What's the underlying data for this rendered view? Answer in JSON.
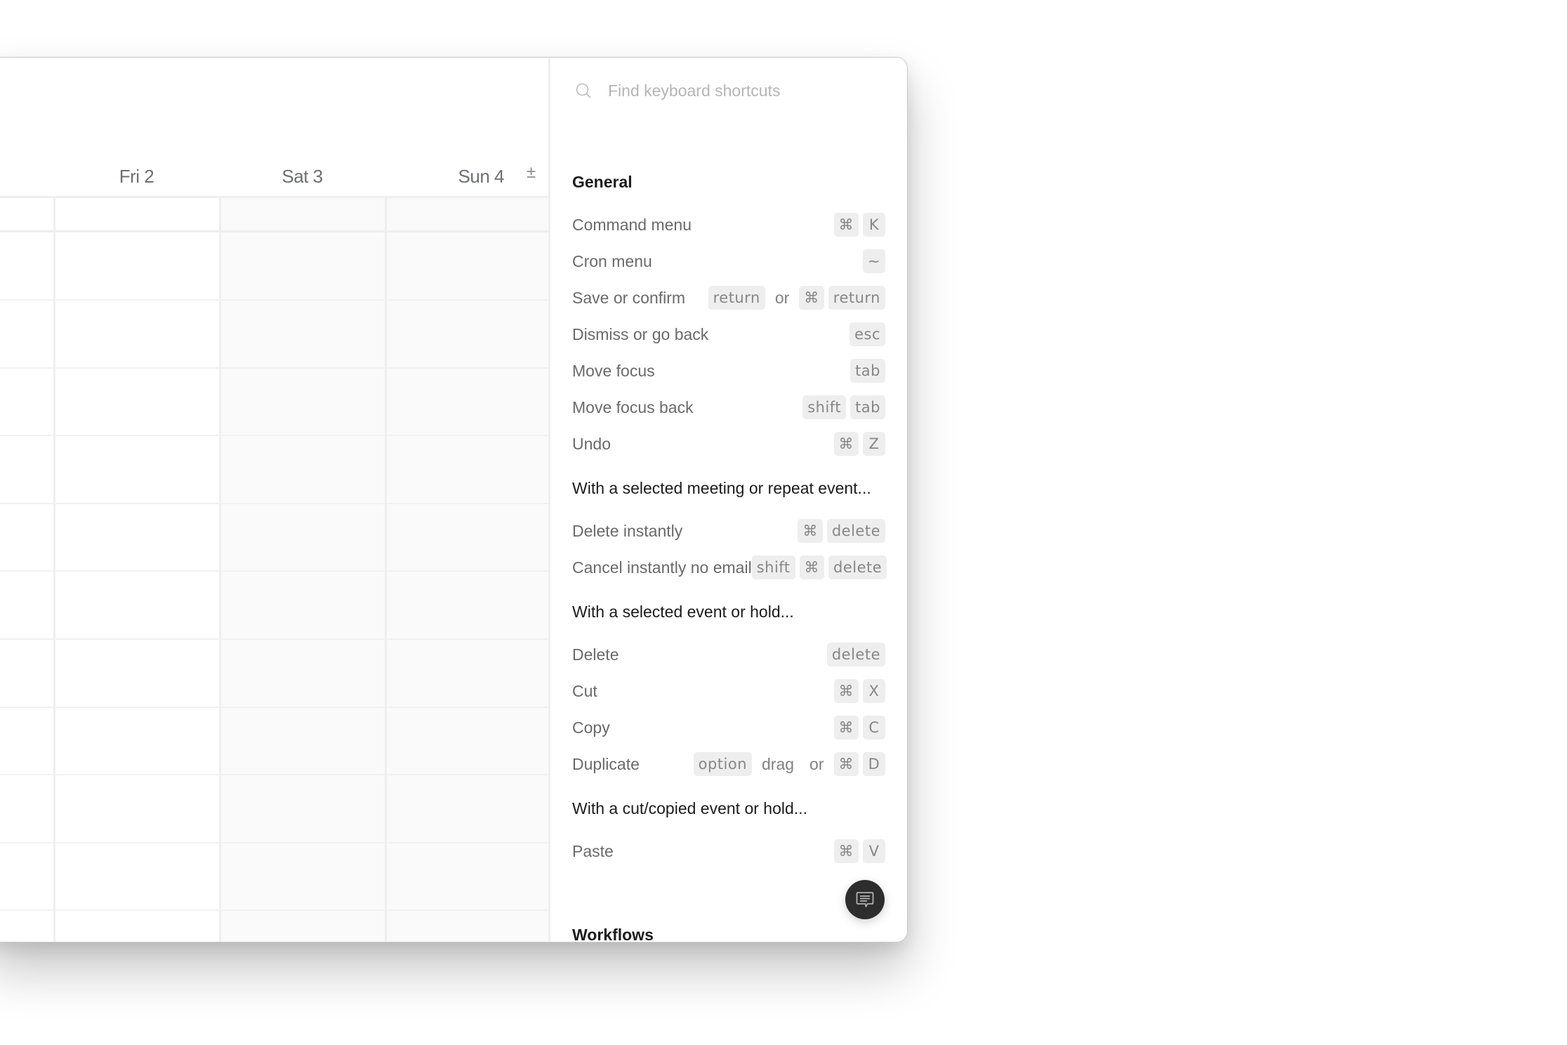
{
  "calendar": {
    "days": [
      {
        "label": "Fri 2",
        "weekend": false
      },
      {
        "label": "Sat 3",
        "weekend": true
      },
      {
        "label": "Sun 4",
        "weekend": true
      }
    ],
    "timezone_toggle": "±"
  },
  "shortcuts": {
    "search": {
      "placeholder": "Find keyboard shortcuts",
      "value": ""
    },
    "general_title": "General",
    "general": [
      {
        "label": "Command menu",
        "keys": [
          {
            "k": "⌘"
          },
          {
            "k": "K"
          }
        ]
      },
      {
        "label": "Cron menu",
        "keys": [
          {
            "k": "~"
          }
        ]
      },
      {
        "label": "Save or confirm",
        "keys": [
          {
            "k": "return"
          },
          {
            "t": "or"
          },
          {
            "k": "⌘"
          },
          {
            "k": "return"
          }
        ]
      },
      {
        "label": "Dismiss or go back",
        "keys": [
          {
            "k": "esc"
          }
        ]
      },
      {
        "label": "Move focus",
        "keys": [
          {
            "k": "tab"
          }
        ]
      },
      {
        "label": "Move focus back",
        "keys": [
          {
            "k": "shift"
          },
          {
            "k": "tab"
          }
        ]
      },
      {
        "label": "Undo",
        "keys": [
          {
            "k": "⌘"
          },
          {
            "k": "Z"
          }
        ]
      }
    ],
    "meeting_title": "With a selected meeting or repeat event...",
    "meeting": [
      {
        "label": "Delete instantly",
        "keys": [
          {
            "k": "⌘"
          },
          {
            "k": "delete"
          }
        ]
      },
      {
        "label": "Cancel instantly no email",
        "keys": [
          {
            "k": "shift"
          },
          {
            "k": "⌘"
          },
          {
            "k": "delete"
          }
        ]
      }
    ],
    "event_title": "With a selected event or hold...",
    "event": [
      {
        "label": "Delete",
        "keys": [
          {
            "k": "delete"
          }
        ]
      },
      {
        "label": "Cut",
        "keys": [
          {
            "k": "⌘"
          },
          {
            "k": "X"
          }
        ]
      },
      {
        "label": "Copy",
        "keys": [
          {
            "k": "⌘"
          },
          {
            "k": "C"
          }
        ]
      },
      {
        "label": "Duplicate",
        "keys": [
          {
            "k": "option"
          },
          {
            "t": "drag"
          },
          {
            "t": "or"
          },
          {
            "k": "⌘"
          },
          {
            "k": "D"
          }
        ]
      }
    ],
    "copied_title": "With a cut/copied event or hold...",
    "copied": [
      {
        "label": "Paste",
        "keys": [
          {
            "k": "⌘"
          },
          {
            "k": "V"
          }
        ]
      }
    ],
    "workflows_title": "Workflows"
  },
  "chat_button": {
    "icon": "chat-bubble-icon"
  }
}
